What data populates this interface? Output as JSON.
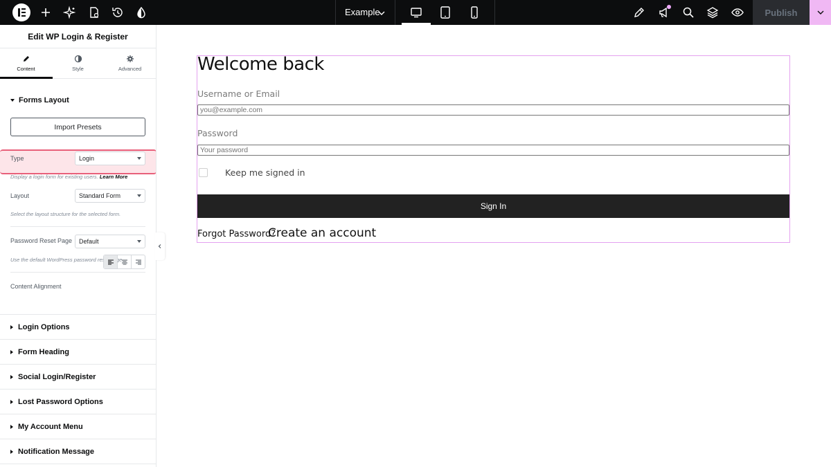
{
  "topbar": {
    "site_name": "Example",
    "publish_label": "Publish",
    "icons": [
      "elementor-logo",
      "add-icon",
      "ai-sparkle-icon",
      "page-settings-icon",
      "history-icon",
      "style-drop-icon",
      "edit-pen-icon",
      "announcements-icon",
      "search-icon",
      "structure-layers-icon",
      "preview-eye-icon"
    ],
    "devices": [
      "desktop",
      "tablet",
      "mobile"
    ],
    "active_device": "desktop"
  },
  "panel": {
    "title": "Edit WP Login & Register",
    "tabs": [
      {
        "label": "Content",
        "icon": "pencil-icon"
      },
      {
        "label": "Style",
        "icon": "half-circle-icon"
      },
      {
        "label": "Advanced",
        "icon": "gear-icon"
      }
    ],
    "active_tab": "Content",
    "forms_layout": {
      "heading": "Forms Layout",
      "import_presets": "Import Presets",
      "type_label": "Type",
      "type_value": "Login",
      "type_desc": "Display a login form for existing users.",
      "type_desc_link": "Learn More",
      "layout_label": "Layout",
      "layout_value": "Standard Form",
      "layout_desc": "Select the layout structure for the selected form.",
      "reset_label": "Password Reset Page",
      "reset_value": "Default",
      "reset_desc": "Use the default WordPress password reset page.",
      "alignment_label": "Content Alignment",
      "alignment_value": "left"
    },
    "sections": [
      "Login Options",
      "Form Heading",
      "Social Login/Register",
      "Lost Password Options",
      "My Account Menu",
      "Notification Message"
    ]
  },
  "preview": {
    "heading": "Welcome back",
    "username_label": "Username or Email",
    "username_placeholder": "you@example.com",
    "password_label": "Password",
    "password_placeholder": "Your password",
    "remember_label": "Keep me signed in",
    "remember_checked": false,
    "signin_label": "Sign In",
    "forgot_label": "Forgot Password?",
    "create_label": "Create an account"
  },
  "colors": {
    "topbar_bg": "#0c0d0e",
    "accent_pink": "#f0b8f4",
    "highlight_border": "#e8607a",
    "highlight_bg": "#fde5e9",
    "button_dark": "#222222"
  }
}
